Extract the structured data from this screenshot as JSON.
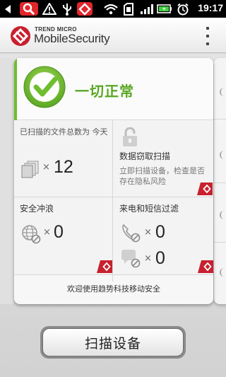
{
  "status_bar": {
    "time": "19:17",
    "icons": [
      "back-icon",
      "search-icon",
      "warning-icon",
      "usb-icon",
      "trend-micro-notification-icon",
      "wifi-icon",
      "sd-card-icon",
      "battery-icon",
      "alarm-icon",
      "signal-icon"
    ]
  },
  "header": {
    "brand_top": "TREND MICRO",
    "brand_main": "MobileSecurity",
    "menu_icon": "overflow-menu-icon"
  },
  "status": {
    "text": "一切正常",
    "icon": "check-circle-icon",
    "accent": "#6fbe2e"
  },
  "tiles": {
    "files_scanned": {
      "label": "已扫描的文件总数为 今天",
      "count": "12",
      "times": "×",
      "icon": "files-icon"
    },
    "privacy": {
      "title": "数据窃取扫描",
      "desc": "立即扫描设备，检查是否存在隐私风险",
      "icon": "lock-icon"
    },
    "web": {
      "title": "安全冲浪",
      "count": "0",
      "times": "×",
      "icon": "globe-blocked-icon"
    },
    "call_sms": {
      "title": "来电和短信过滤",
      "call_count": "0",
      "sms_count": "0",
      "times": "×",
      "icons": [
        "phone-blocked-icon",
        "message-blocked-icon"
      ]
    }
  },
  "welcome": "欢迎使用趋势科技移动安全",
  "scan_button": "扫描设备",
  "colors": {
    "brand_red": "#c8202f",
    "ok_green": "#5aa724"
  }
}
